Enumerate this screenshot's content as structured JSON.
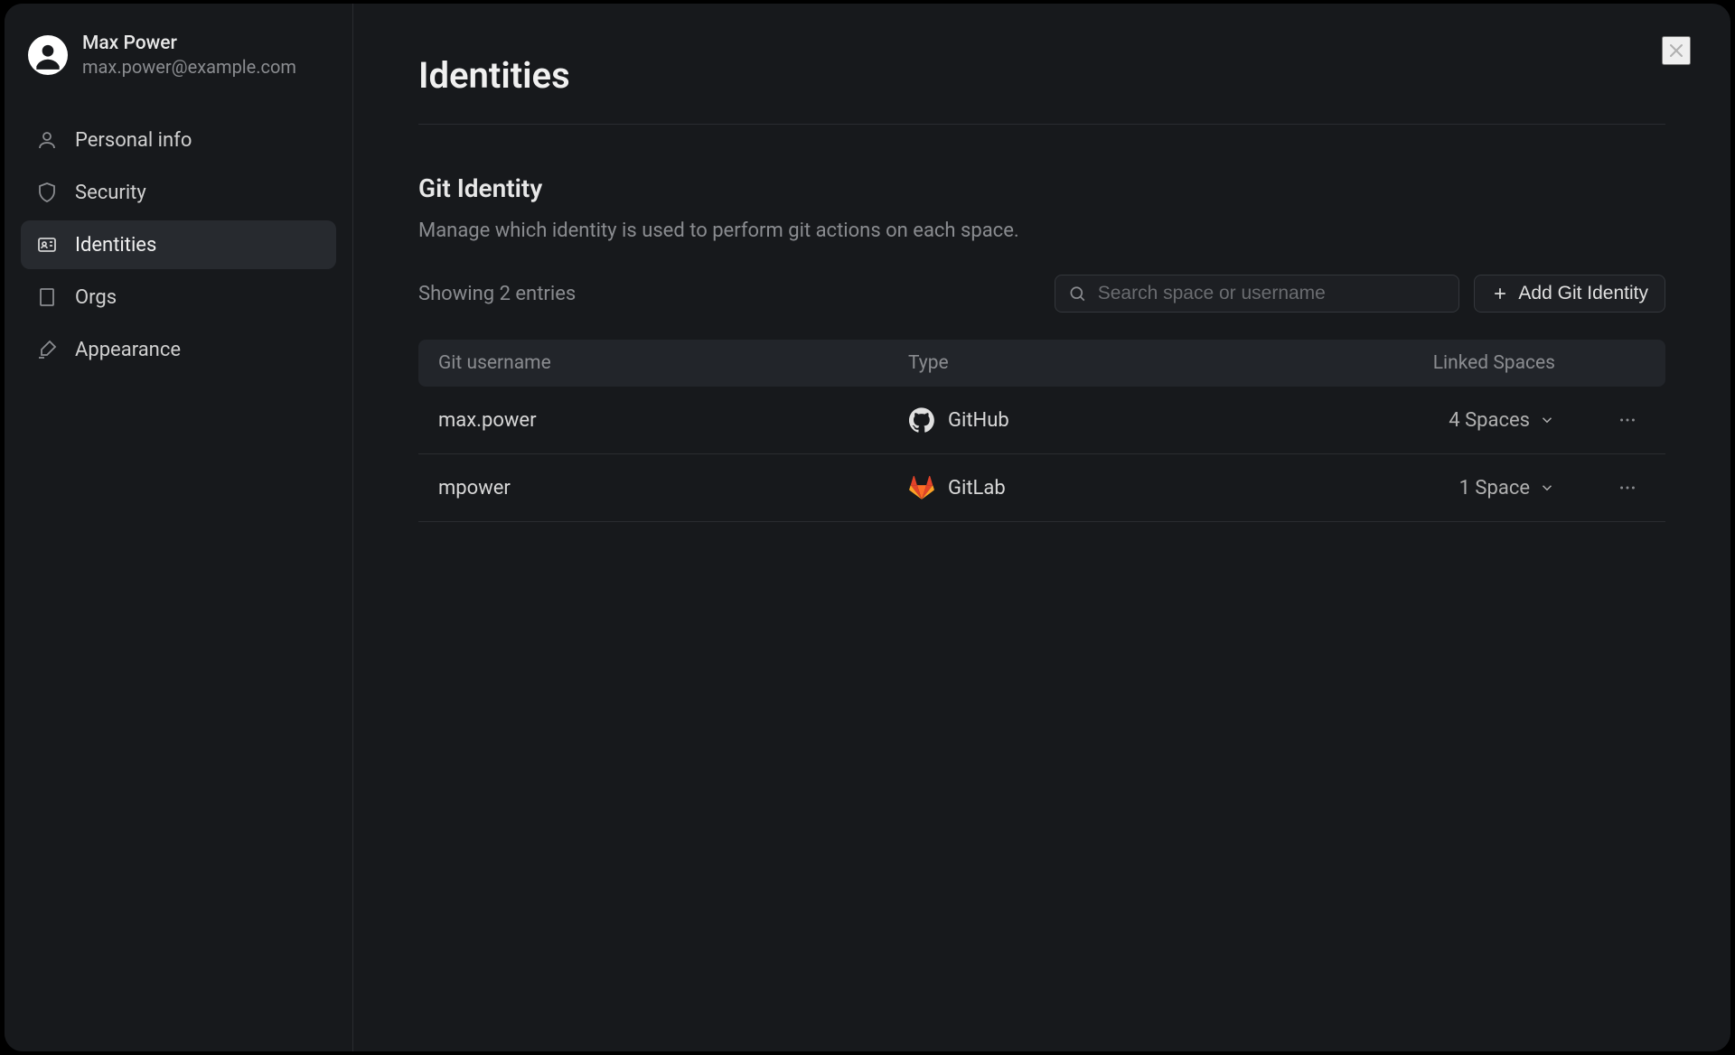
{
  "profile": {
    "name": "Max Power",
    "email": "max.power@example.com"
  },
  "sidebar": {
    "items": [
      {
        "label": "Personal info",
        "icon": "user-icon",
        "active": false
      },
      {
        "label": "Security",
        "icon": "shield-icon",
        "active": false
      },
      {
        "label": "Identities",
        "icon": "id-card-icon",
        "active": true
      },
      {
        "label": "Orgs",
        "icon": "building-icon",
        "active": false
      },
      {
        "label": "Appearance",
        "icon": "brush-icon",
        "active": false
      }
    ]
  },
  "page": {
    "title": "Identities"
  },
  "section": {
    "title": "Git Identity",
    "description": "Manage which identity is used to perform git actions on each space."
  },
  "toolbar": {
    "entries_label": "Showing 2 entries",
    "search_placeholder": "Search space or username",
    "add_label": "Add Git Identity"
  },
  "table": {
    "columns": {
      "username": "Git username",
      "type": "Type",
      "spaces": "Linked Spaces"
    },
    "rows": [
      {
        "username": "max.power",
        "type": "GitHub",
        "provider": "github",
        "spaces_label": "4 Spaces"
      },
      {
        "username": "mpower",
        "type": "GitLab",
        "provider": "gitlab",
        "spaces_label": "1 Space"
      }
    ]
  }
}
